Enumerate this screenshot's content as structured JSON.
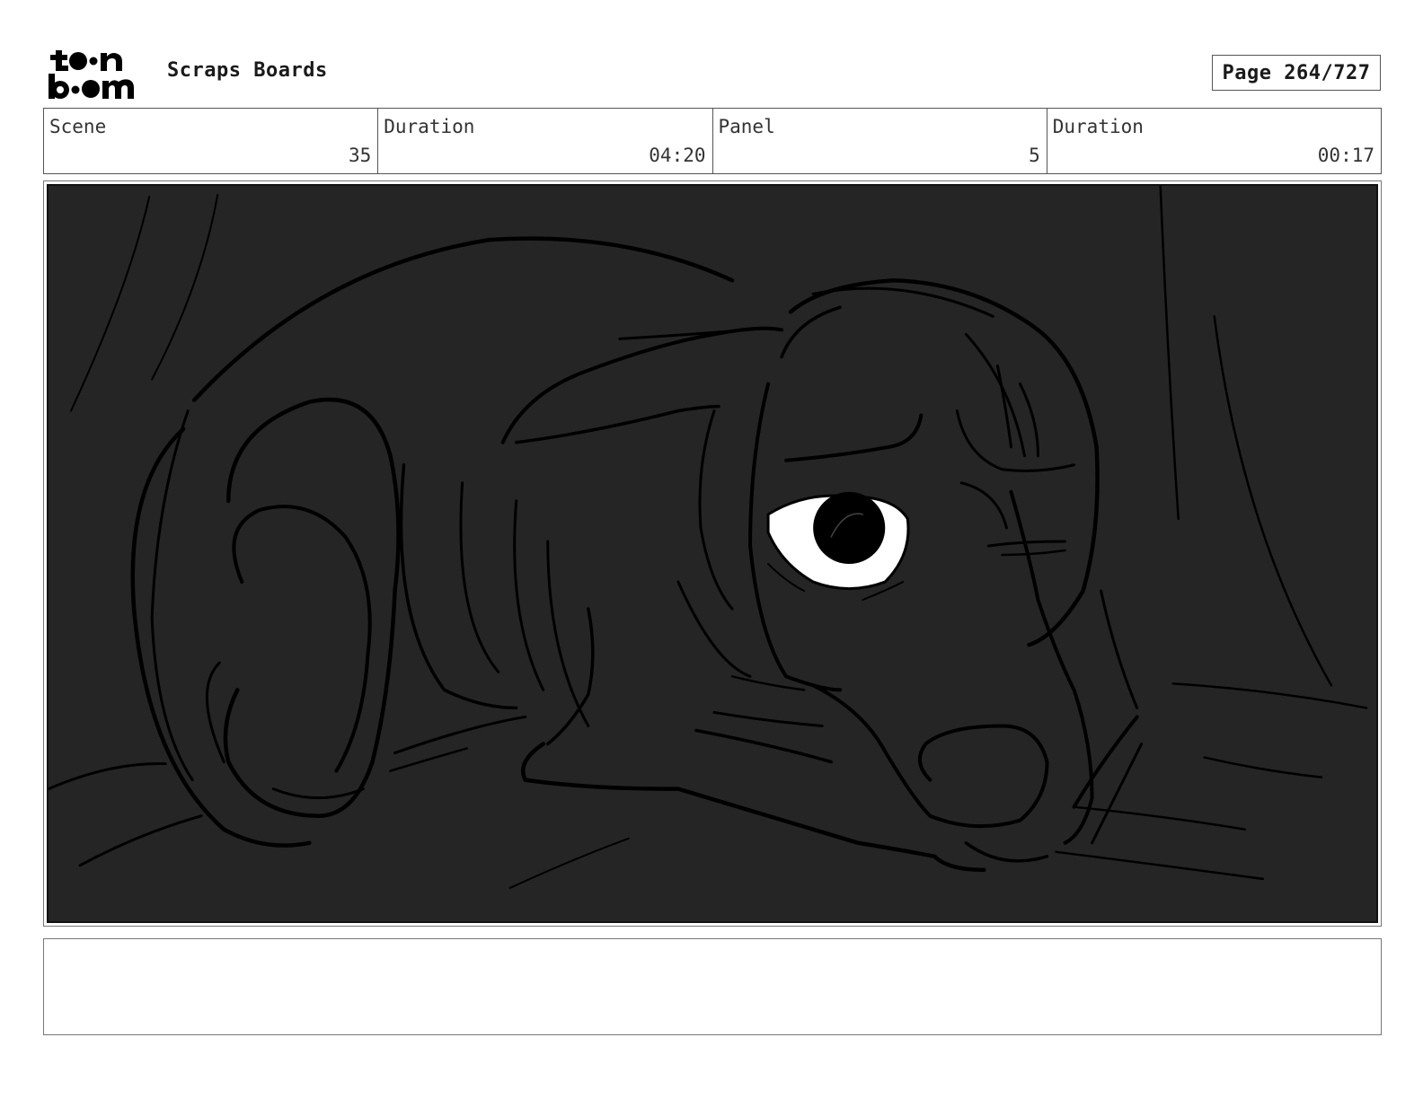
{
  "header": {
    "logo_text": "toon boom",
    "title": "Scraps Boards",
    "page": "Page 264/727"
  },
  "info": {
    "scene_label": "Scene",
    "scene_value": "35",
    "scene_duration_label": "Duration",
    "scene_duration_value": "04:20",
    "panel_label": "Panel",
    "panel_value": "5",
    "panel_duration_label": "Duration",
    "panel_duration_value": "00:17"
  },
  "caption": {
    "text": ""
  },
  "colors": {
    "panel_bg": "#252525",
    "line": "#000000",
    "eye_white": "#ffffff"
  }
}
